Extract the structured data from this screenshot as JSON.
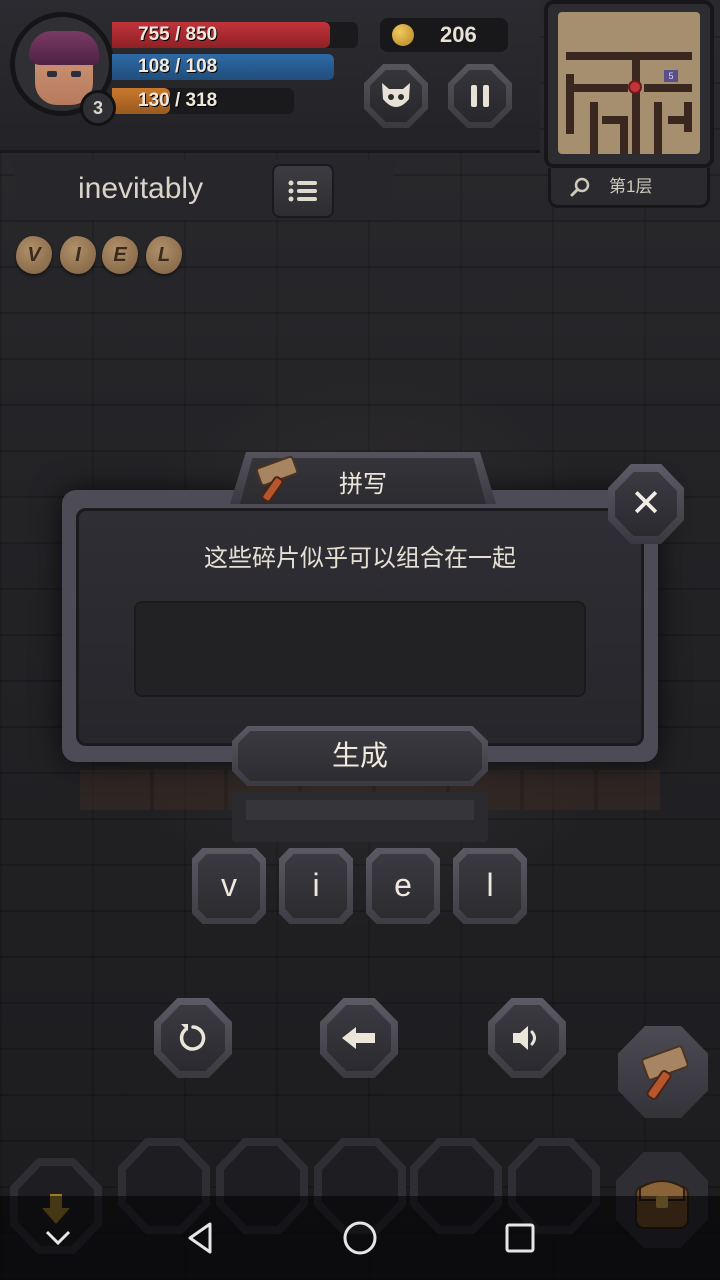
{
  "hud": {
    "hp": "755 / 850",
    "hp_fraction": 0.888,
    "mp": "108 / 108",
    "mp_fraction": 1.0,
    "xp": "130 / 318",
    "xp_fraction": 0.409,
    "level": "3",
    "gold": "206"
  },
  "minimap": {
    "floor_label": "第1层",
    "marker_number": "5"
  },
  "word_panel": {
    "word": "inevitably"
  },
  "fragments": [
    "V",
    "I",
    "E",
    "L"
  ],
  "dialog": {
    "title": "拼写",
    "message": "这些碎片似乎可以组合在一起",
    "input_value": "",
    "generate_label": "生成",
    "close_label": "✕"
  },
  "letter_tiles": [
    "v",
    "i",
    "e",
    "l"
  ],
  "icons": {
    "monster": "monster-icon",
    "pause": "pause-icon",
    "search": "search-icon",
    "list": "list-icon",
    "hammer": "hammer-icon",
    "reset": "reset-icon",
    "backspace": "backspace-icon",
    "sound": "sound-icon",
    "bag": "bag-icon",
    "down_arrow": "down-arrow-icon"
  },
  "colors": {
    "hp": "#c0343a",
    "mp": "#2f6aa6",
    "xp": "#c9782d"
  }
}
